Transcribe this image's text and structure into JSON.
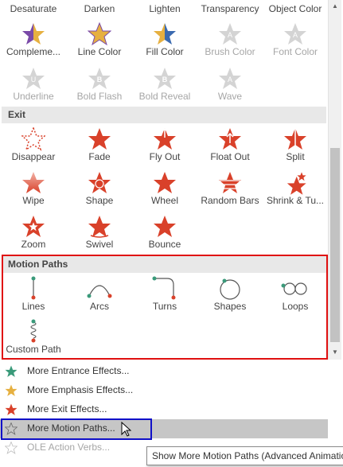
{
  "emphasis_labels_row1": [
    "Desaturate",
    "Darken",
    "Lighten",
    "Transparency",
    "Object Color"
  ],
  "emphasis_row2": [
    {
      "label": "Compleme...",
      "icon": "star-complementary-icon",
      "disabled": false
    },
    {
      "label": "Line Color",
      "icon": "star-line-color-icon",
      "disabled": false
    },
    {
      "label": "Fill Color",
      "icon": "star-fill-color-icon",
      "disabled": false
    },
    {
      "label": "Brush Color",
      "icon": "star-brush-color-icon",
      "disabled": true
    },
    {
      "label": "Font Color",
      "icon": "star-font-color-icon",
      "disabled": true
    }
  ],
  "emphasis_row3": [
    {
      "label": "Underline",
      "icon": "star-underline-icon",
      "disabled": true
    },
    {
      "label": "Bold Flash",
      "icon": "star-bold-flash-icon",
      "disabled": true
    },
    {
      "label": "Bold Reveal",
      "icon": "star-bold-reveal-icon",
      "disabled": true
    },
    {
      "label": "Wave",
      "icon": "star-wave-icon",
      "disabled": true
    }
  ],
  "exit": {
    "title": "Exit",
    "items": [
      {
        "label": "Disappear",
        "icon": "disappear-star-icon"
      },
      {
        "label": "Fade",
        "icon": "fade-star-icon"
      },
      {
        "label": "Fly Out",
        "icon": "fly-out-star-icon"
      },
      {
        "label": "Float Out",
        "icon": "float-out-star-icon"
      },
      {
        "label": "Split",
        "icon": "split-star-icon"
      },
      {
        "label": "Wipe",
        "icon": "wipe-star-icon"
      },
      {
        "label": "Shape",
        "icon": "shape-star-icon"
      },
      {
        "label": "Wheel",
        "icon": "wheel-star-icon"
      },
      {
        "label": "Random Bars",
        "icon": "random-bars-star-icon"
      },
      {
        "label": "Shrink & Tu...",
        "icon": "shrink-turn-star-icon"
      },
      {
        "label": "Zoom",
        "icon": "zoom-star-icon"
      },
      {
        "label": "Swivel",
        "icon": "swivel-star-icon"
      },
      {
        "label": "Bounce",
        "icon": "bounce-star-icon"
      }
    ]
  },
  "motion_paths": {
    "title": "Motion Paths",
    "items": [
      {
        "label": "Lines",
        "icon": "lines-path-icon"
      },
      {
        "label": "Arcs",
        "icon": "arcs-path-icon"
      },
      {
        "label": "Turns",
        "icon": "turns-path-icon"
      },
      {
        "label": "Shapes",
        "icon": "shapes-path-icon"
      },
      {
        "label": "Loops",
        "icon": "loops-path-icon"
      },
      {
        "label": "Custom Path",
        "icon": "custom-path-icon"
      }
    ]
  },
  "menu": [
    {
      "label": "More Entrance Effects...",
      "icon": "entrance-star-icon",
      "color": "#3a9a7a",
      "disabled": false
    },
    {
      "label": "More Emphasis Effects...",
      "icon": "emphasis-star-icon",
      "color": "#e6b040",
      "disabled": false
    },
    {
      "label": "More Exit Effects...",
      "icon": "exit-star-icon",
      "color": "#d9412a",
      "disabled": false
    },
    {
      "label": "More Motion Paths...",
      "icon": "motion-path-star-icon",
      "color": "#888888",
      "disabled": false,
      "highlighted": true
    },
    {
      "label": "OLE Action Verbs...",
      "icon": "ole-star-icon",
      "color": "#bdbdbd",
      "disabled": true
    }
  ],
  "tooltip": "Show More Motion Paths (Advanced Animation)",
  "colors": {
    "exit_red": "#d9412a",
    "motion_teal": "#3a9a7a",
    "motion_red": "#d9412a",
    "highlight_box": "#e01010",
    "focus_box": "#1010c8"
  }
}
